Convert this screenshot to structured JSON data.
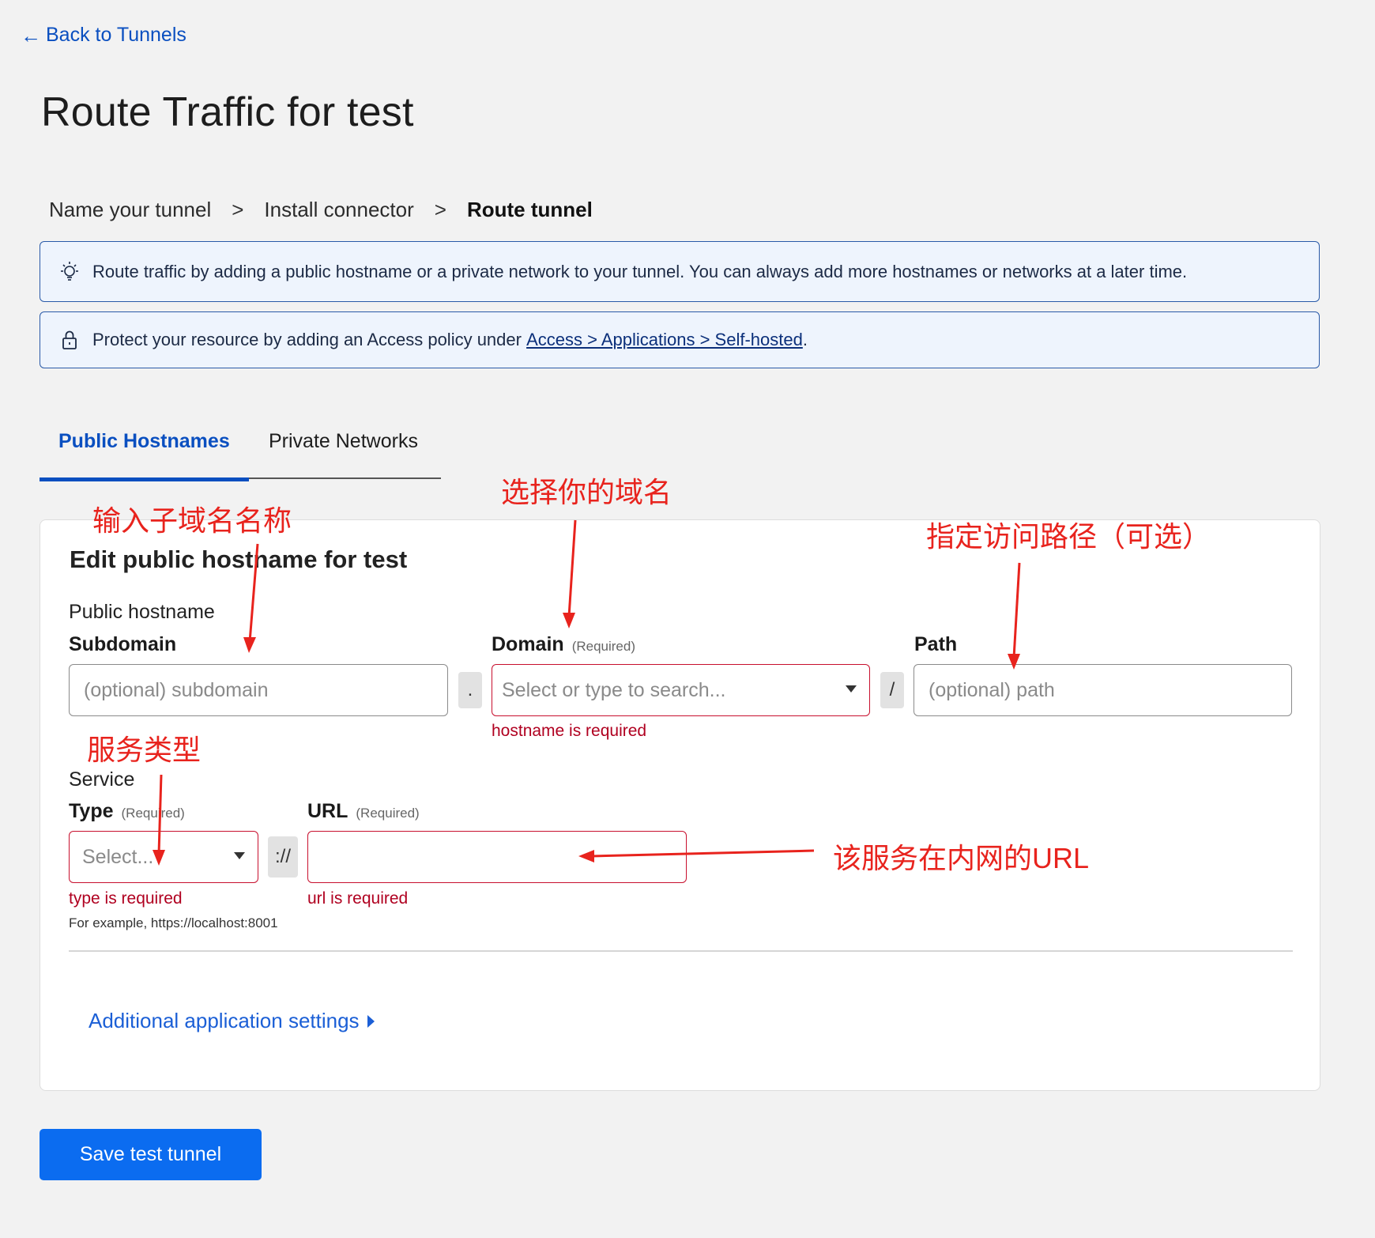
{
  "back_link": {
    "arrow": "←",
    "label": "Back to Tunnels"
  },
  "page_title": "Route Traffic for test",
  "steps": [
    {
      "label": "Name your tunnel"
    },
    {
      "label": "Install connector"
    },
    {
      "label": "Route tunnel"
    }
  ],
  "step_separator": ">",
  "banners": {
    "info_text": "Route traffic by adding a public hostname or a private network to your tunnel. You can always add more hostnames or networks at a later time.",
    "info_icon": "lightbulb-icon",
    "access_prefix": "Protect your resource by adding an Access policy under ",
    "access_link": "Access > Applications > Self-hosted",
    "access_suffix": ".",
    "access_icon": "lock-icon"
  },
  "tabs": [
    {
      "label": "Public Hostnames",
      "active": true
    },
    {
      "label": "Private Networks",
      "active": false
    }
  ],
  "card": {
    "title": "Edit public hostname for test",
    "hostname_section": "Public hostname",
    "subdomain_label": "Subdomain",
    "subdomain_placeholder": "(optional) subdomain",
    "dot": ".",
    "domain_label": "Domain",
    "domain_required": "(Required)",
    "domain_placeholder": "Select or type to search...",
    "domain_error": "hostname is required",
    "slash": "/",
    "path_label": "Path",
    "path_placeholder": "(optional) path",
    "service_section": "Service",
    "type_label": "Type",
    "type_required": "(Required)",
    "type_placeholder": "Select...",
    "type_error": "type is required",
    "scheme_sep": "://",
    "url_label": "URL",
    "url_required": "(Required)",
    "url_value": "",
    "url_error": "url is required",
    "url_hint": "For example, https://localhost:8001",
    "additional_settings": "Additional application settings"
  },
  "save_button": "Save test tunnel",
  "annotations": {
    "subdomain_note": "输入子域名名称",
    "domain_note": "选择你的域名",
    "path_note": "指定访问路径（可选）",
    "service_type_note": "服务类型",
    "url_note": "该服务在内网的URL"
  },
  "colors": {
    "accent": "#0a4fc0",
    "primary_button": "#0b6cf0",
    "error": "#c8102e",
    "annotation": "#e8231d",
    "banner_bg": "#eef4fd"
  }
}
